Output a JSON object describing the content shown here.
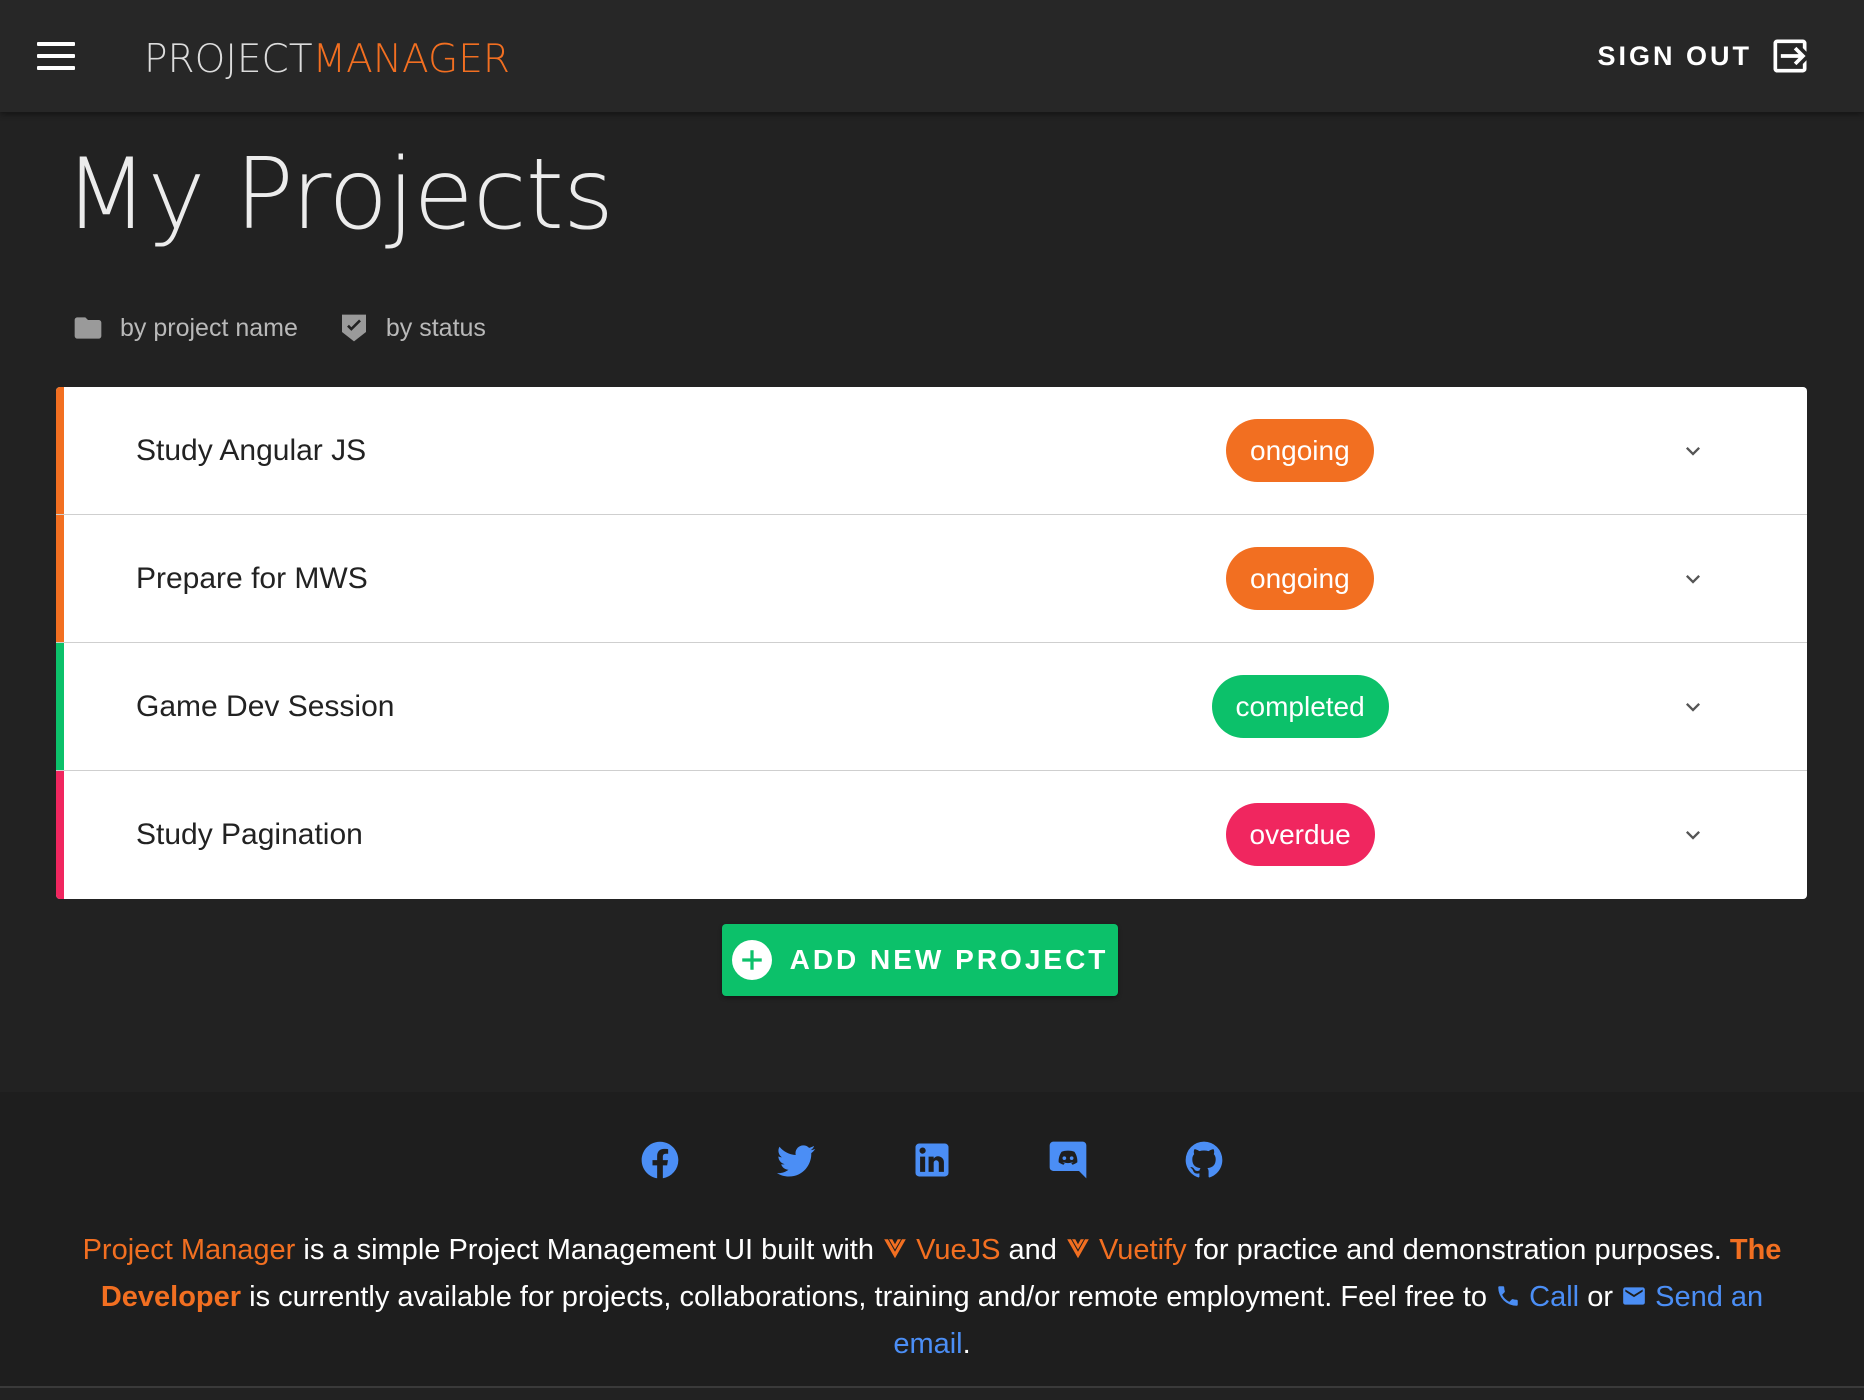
{
  "header": {
    "brand_part1": "PROJECT",
    "brand_part2": "MANAGER",
    "signout_label": "SIGN OUT"
  },
  "page": {
    "title": "My Projects"
  },
  "sort": {
    "by_name": "by project name",
    "by_status": "by status"
  },
  "projects": [
    {
      "title": "Study Angular JS",
      "status": "ongoing"
    },
    {
      "title": "Prepare for MWS",
      "status": "ongoing"
    },
    {
      "title": "Game Dev Session",
      "status": "completed"
    },
    {
      "title": "Study Pagination",
      "status": "overdue"
    }
  ],
  "status_colors": {
    "ongoing": "#f26f21",
    "completed": "#0cc16a",
    "overdue": "#f0265f"
  },
  "add_button": {
    "label": "ADD NEW PROJECT"
  },
  "footer": {
    "socials": [
      "facebook-icon",
      "twitter-icon",
      "linkedin-icon",
      "discord-icon",
      "github-icon"
    ],
    "app_link": "Project Manager",
    "t1": " is a simple Project Management UI built with ",
    "vue_link": "VueJS",
    "t2": " and ",
    "vuetify_link": "Vuetify",
    "t3": " for practice and demonstration purposes. ",
    "dev_link": "The Developer",
    "t4": " is currently available for projects, collaborations, training and/or remote employment. Feel free to ",
    "call_link": "Call",
    "t5": " or ",
    "email_link": "Send an email",
    "t6": "."
  },
  "colors": {
    "accent_orange": "#f26f21",
    "accent_green": "#0cc16a",
    "accent_pink": "#f0265f",
    "link_blue": "#4b8ef5"
  }
}
